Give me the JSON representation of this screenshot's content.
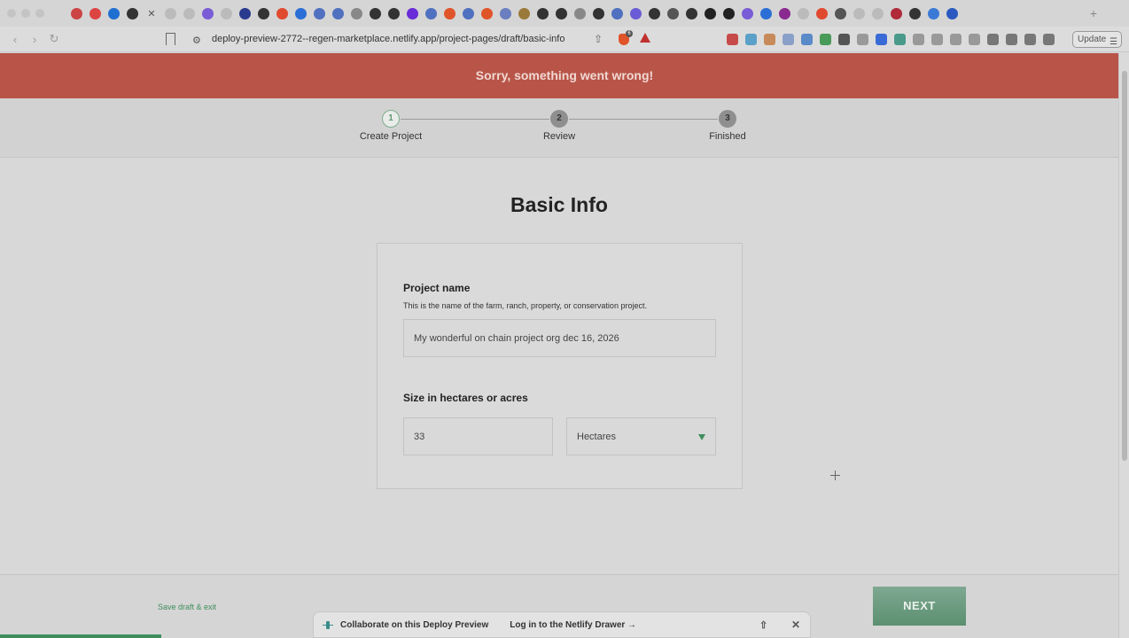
{
  "browser": {
    "url": "deploy-preview-2772--regen-marketplace.netlify.app/project-pages/draft/basic-info",
    "update_label": "Update",
    "tab_favicon_colors": [
      "#c44",
      "#d44",
      "#1f6fd1",
      "#333",
      "#bbb",
      "#bbb",
      "#7a5cd6",
      "#bbb",
      "#2a3a8f",
      "#333",
      "#e04a2f",
      "#2a6fd6",
      "#5070c0",
      "#5070c0",
      "#888",
      "#333",
      "#333",
      "#6a2bd8",
      "#5070c0",
      "#e0542a",
      "#5070c0",
      "#e0542a",
      "#6a7ec0",
      "#9a7a3a",
      "#333",
      "#333",
      "#888",
      "#333",
      "#5070c0",
      "#6a5cd6",
      "#333",
      "#555",
      "#333",
      "#222",
      "#222",
      "#7a5cd6",
      "#2a6fd6",
      "#8a2a8f",
      "#bbb",
      "#e04a2f",
      "#555",
      "#bbb",
      "#bbb",
      "#b02a3a",
      "#333",
      "#3a7ad6",
      "#2a5ac0"
    ],
    "ext_icon_colors": [
      "#c64a4a",
      "#5aa0c8",
      "#c88a5a",
      "#8aa0c8",
      "#5a8ac8",
      "#4a9a5a",
      "#555",
      "#999",
      "#3a6ad6",
      "#4a9a8a",
      "#999",
      "#999",
      "#999",
      "#999",
      "#777",
      "#777",
      "#777",
      "#777"
    ]
  },
  "error": {
    "message": "Sorry, something went wrong!"
  },
  "stepper": {
    "steps": [
      {
        "number": "1",
        "label": "Create Project"
      },
      {
        "number": "2",
        "label": "Review"
      },
      {
        "number": "3",
        "label": "Finished"
      }
    ]
  },
  "page": {
    "title": "Basic Info"
  },
  "form": {
    "project_name_label": "Project name",
    "project_name_help": "This is the name of the farm, ranch, property, or conservation project.",
    "project_name_value": "My wonderful on chain project org dec 16, 2026",
    "size_label": "Size in hectares or acres",
    "size_value": "33",
    "unit_value": "Hectares"
  },
  "footer": {
    "save_label": "Save draft & exit",
    "next_label": "NEXT"
  },
  "netlify": {
    "collab_label": "Collaborate on this Deploy Preview",
    "login_label": "Log in to the Netlify Drawer →"
  },
  "colors": {
    "error_banner": "#b85548",
    "accent_green": "#3e8e5c"
  }
}
